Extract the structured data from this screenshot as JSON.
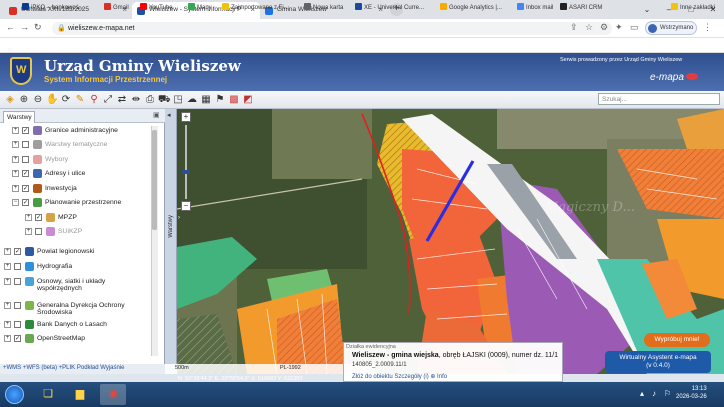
{
  "browser": {
    "tabs": [
      {
        "title": "Uchwała XXII/183/2025",
        "active": false,
        "color": "#d93025"
      },
      {
        "title": "Wieliszew - System Informacji P",
        "active": true,
        "color": "#1f4f9e"
      },
      {
        "title": "Gmina Wieliszew",
        "active": false,
        "color": "#1a73e8"
      }
    ],
    "url": "wieliszew.e-mapa.net",
    "profile_label": "Wstrzymano",
    "bookmarks": [
      {
        "label": "iPKO – bankowoś...",
        "color": "#0b3b8c"
      },
      {
        "label": "Gmail",
        "color": "#d93025"
      },
      {
        "label": "YouTube",
        "color": "#ff0000"
      },
      {
        "label": "Mapy",
        "color": "#34a853"
      },
      {
        "label": "Zaimportowane z Fi...",
        "color": "#f4c20d"
      },
      {
        "label": "Nowa karta",
        "color": "#5f6368"
      },
      {
        "label": "XE - Universal Curre...",
        "color": "#1a4a9c"
      },
      {
        "label": "Google Analytics |...",
        "color": "#f9ab00"
      },
      {
        "label": "Inbox mail",
        "color": "#4285f4"
      },
      {
        "label": "ASARI CRM",
        "color": "#222222"
      },
      {
        "label": "Inne zakładki",
        "color": "#f4c20d"
      }
    ]
  },
  "app": {
    "title": "Urząd Gminy Wieliszew",
    "subtitle": "System Informacji Przestrzennej",
    "provider_text": "Serwis prowadzony przez Urząd Gminy Wieliszew",
    "brand": "e-mapa",
    "search_placeholder": "Szukaj..."
  },
  "toolbar": {
    "icons": [
      "layers-icon",
      "zoom-in-icon",
      "zoom-out-icon",
      "pan-hand-icon",
      "rotate-icon",
      "pencil-icon",
      "pin-icon",
      "measure-icon",
      "arrows-icon",
      "ruler-icon",
      "print-icon",
      "car-icon",
      "camera-icon",
      "cloud-icon",
      "layer-tools-icon",
      "flag-icon",
      "grid-icon",
      "bookmark-icon"
    ]
  },
  "panel": {
    "tab_label": "Warstwy",
    "layers": [
      {
        "label": "Granice administracyjne",
        "indent": 1,
        "checked": true,
        "muted": false,
        "color": "#7f6db0"
      },
      {
        "label": "Warstwy tematyczne",
        "indent": 1,
        "checked": false,
        "muted": true,
        "color": "#9e9e9e"
      },
      {
        "label": "Wybory",
        "indent": 1,
        "checked": false,
        "muted": true,
        "color": "#e6a0a0"
      },
      {
        "label": "Adresy i ulice",
        "indent": 1,
        "checked": true,
        "muted": false,
        "color": "#3b66b0"
      },
      {
        "label": "Inwestycja",
        "indent": 1,
        "checked": true,
        "muted": false,
        "color": "#b05a1a"
      },
      {
        "label": "Planowanie przestrzenne",
        "indent": 1,
        "checked": true,
        "muted": false,
        "color": "#4b9b45",
        "expanded": true
      },
      {
        "label": "MPZP",
        "indent": 2,
        "checked": true,
        "muted": false,
        "color": "#d7a34a"
      },
      {
        "label": "SUiKZP",
        "indent": 2,
        "checked": false,
        "muted": true,
        "color": "#c98cd3"
      },
      {
        "label": "Powiat legionowski",
        "indent": 0,
        "checked": true,
        "muted": false,
        "color": "#2c5aa0"
      },
      {
        "label": "Hydrografia",
        "indent": 0,
        "checked": false,
        "muted": false,
        "color": "#2f8fd9"
      },
      {
        "label": "Osnowy, siatki i układy",
        "label2": "współrzędnych",
        "indent": 0,
        "checked": false,
        "muted": false,
        "color": "#4aa3d8"
      },
      {
        "label": "Generalna Dyrekcja Ochrony",
        "label2": "Środowiska",
        "indent": 0,
        "checked": false,
        "muted": false,
        "color": "#7ab648"
      },
      {
        "label": "Bank Danych o Lasach",
        "indent": 0,
        "checked": false,
        "muted": false,
        "color": "#2d8a3a"
      },
      {
        "label": "OpenStreetMap",
        "indent": 0,
        "checked": true,
        "muted": false,
        "color": "#6aa84f"
      }
    ],
    "bottom_links": "+WMS  +WFS (beta)  +PLIK  Podkład  Wyjaśnie"
  },
  "sidebar_label": "Warstwy",
  "map": {
    "scale_label": "500m",
    "crs": "PL-1992",
    "coords": "N: 52°26'44.3\"  E: 20°58'54.3\"  X: 519683  Y: 632383",
    "watermark": "Magiczny D..."
  },
  "info_popup": {
    "header": "Działka ewidencyjna",
    "title_prefix": "Wieliszew - gmina wiejska",
    "title_rest": ", obręb ŁAJSKI (0009), numer dz. 11/1",
    "parcel_id": "140805_2.0009.11/1",
    "links": "Złóż do obiektu   Szczegóły (i)   ⊕   Info"
  },
  "buttons": {
    "try_label": "Wypróbuj mnie!",
    "assistant_line1": "Wirtualny Asystent e-mapa",
    "assistant_line2": "(v 0.4.0)"
  },
  "taskbar": {
    "time": "13:13",
    "date": "2026-03-26"
  }
}
